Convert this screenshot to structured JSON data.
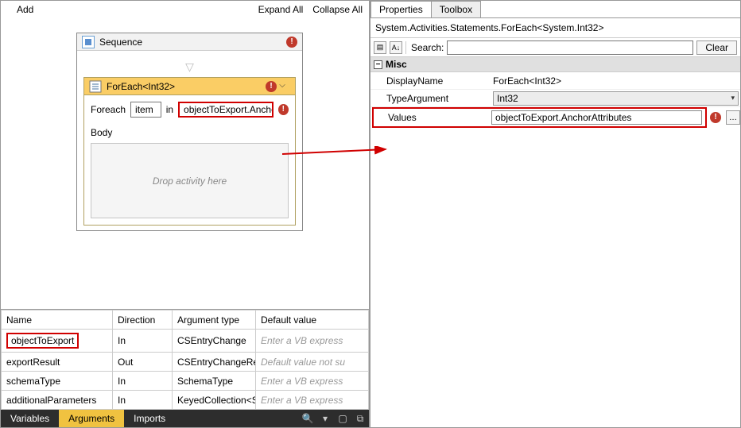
{
  "toolbar": {
    "add": "Add",
    "expand_all": "Expand All",
    "collapse_all": "Collapse All"
  },
  "sequence": {
    "title": "Sequence"
  },
  "foreach": {
    "title": "ForEach<Int32>",
    "foreach_label": "Foreach",
    "item_value": "item",
    "in_label": "in",
    "in_expr": "objectToExport.Anchor",
    "body_label": "Body",
    "drop_hint": "Drop activity here"
  },
  "args": {
    "headers": {
      "name": "Name",
      "direction": "Direction",
      "type": "Argument type",
      "default": "Default value"
    },
    "rows": [
      {
        "name": "objectToExport",
        "direction": "In",
        "type": "CSEntryChange",
        "default": "Enter a VB express",
        "italic": true,
        "highlight": true
      },
      {
        "name": "exportResult",
        "direction": "Out",
        "type": "CSEntryChangeRes",
        "default": "Default value not su",
        "italic": true
      },
      {
        "name": "schemaType",
        "direction": "In",
        "type": "SchemaType",
        "default": "Enter a VB express",
        "italic": true
      },
      {
        "name": "additionalParameters",
        "direction": "In",
        "type": "KeyedCollection<S",
        "default": "Enter a VB express",
        "italic": true
      }
    ]
  },
  "bottom_tabs": {
    "variables": "Variables",
    "arguments": "Arguments",
    "imports": "Imports"
  },
  "right": {
    "tabs": {
      "properties": "Properties",
      "toolbox": "Toolbox"
    },
    "breadcrumb": "System.Activities.Statements.ForEach<System.Int32>",
    "search_label": "Search:",
    "clear": "Clear",
    "misc": "Misc",
    "props": {
      "displayname_label": "DisplayName",
      "displayname_value": "ForEach<Int32>",
      "typearg_label": "TypeArgument",
      "typearg_value": "Int32",
      "values_label": "Values",
      "values_value": "objectToExport.AnchorAttributes"
    }
  }
}
